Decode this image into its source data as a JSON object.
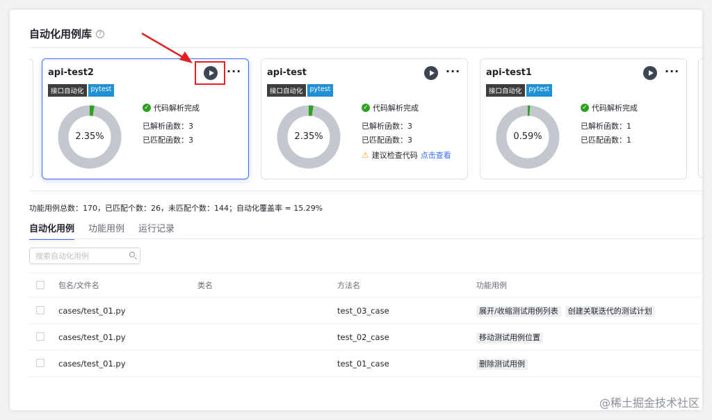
{
  "header": {
    "title": "自动化用例库",
    "help": "?"
  },
  "cards": [
    {
      "name": "api-test2",
      "tags": [
        "接口自动化",
        "pytest"
      ],
      "percent": "2.35%",
      "fraction": 0.0235,
      "status": "代码解析完成",
      "parsed_label": "已解析函数：",
      "parsed": "3",
      "matched_label": "已匹配函数：",
      "matched": "3",
      "selected": true
    },
    {
      "name": "api-test",
      "tags": [
        "接口自动化",
        "pytest"
      ],
      "percent": "2.35%",
      "fraction": 0.0235,
      "status": "代码解析完成",
      "parsed_label": "已解析函数：",
      "parsed": "3",
      "matched_label": "已匹配函数：",
      "matched": "3",
      "warning": "建议检查代码",
      "warning_link": "点击查看"
    },
    {
      "name": "api-test1",
      "tags": [
        "接口自动化",
        "pytest"
      ],
      "percent": "0.59%",
      "fraction": 0.0059,
      "status": "代码解析完成",
      "parsed_label": "已解析函数：",
      "parsed": "1",
      "matched_label": "已匹配函数：",
      "matched": "1"
    }
  ],
  "colors": {
    "donut_track": "#c3c8cf",
    "donut_fill": "#2ea121",
    "accent": "#3370ff",
    "annotation": "#e32020"
  },
  "summary": "功能用例总数：170，已匹配个数：26，未匹配个数：144；自动化覆盖率 = 15.29%",
  "tabs": [
    "自动化用例",
    "功能用例",
    "运行记录"
  ],
  "search": {
    "placeholder": "搜索自动化用例"
  },
  "table": {
    "headers": [
      "包名/文件名",
      "类名",
      "方法名",
      "功能用例"
    ],
    "rows": [
      {
        "file": "cases/test_01.py",
        "class": "",
        "method": "test_03_case",
        "cases": [
          "展开/收缩测试用例列表",
          "创建关联迭代的测试计划"
        ]
      },
      {
        "file": "cases/test_01.py",
        "class": "",
        "method": "test_02_case",
        "cases": [
          "移动测试用例位置"
        ]
      },
      {
        "file": "cases/test_01.py",
        "class": "",
        "method": "test_01_case",
        "cases": [
          "删除测试用例"
        ]
      }
    ]
  },
  "watermark": "@稀土掘金技术社区"
}
